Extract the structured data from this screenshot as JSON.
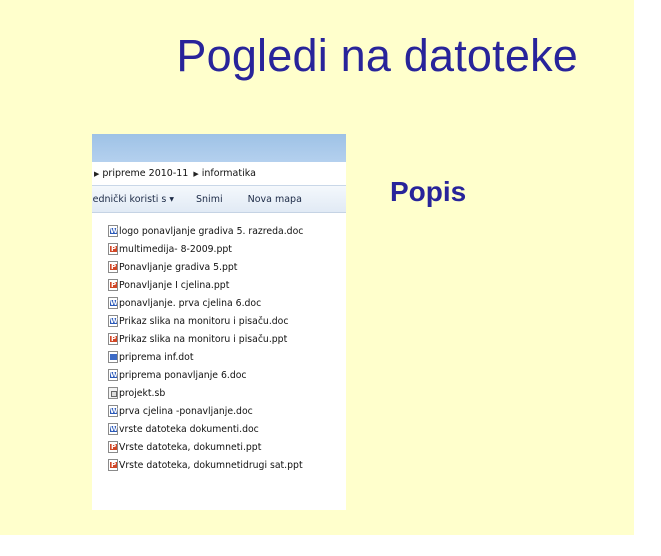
{
  "slide": {
    "title": "Pogledi na datoteke",
    "subtitle": "Popis"
  },
  "explorer": {
    "breadcrumb": [
      "pripreme 2010-11",
      "informatika"
    ],
    "toolbar": {
      "share_label": "jednički koristi s",
      "save_label": "Snimi",
      "new_folder_label": "Nova mapa"
    },
    "files": [
      {
        "name": "logo ponavljanje gradiva 5. razreda.doc",
        "icon": "word-doc-icon"
      },
      {
        "name": "multimedija- 8-2009.ppt",
        "icon": "powerpoint-icon"
      },
      {
        "name": "Ponavljanje gradiva 5.ppt",
        "icon": "powerpoint-icon"
      },
      {
        "name": "Ponavljanje I cjelina.ppt",
        "icon": "powerpoint-icon"
      },
      {
        "name": "ponavljanje. prva cjelina 6.doc",
        "icon": "word-doc-icon"
      },
      {
        "name": "Prikaz slika na monitoru i pisaču.doc",
        "icon": "word-doc-icon"
      },
      {
        "name": "Prikaz slika na monitoru i pisaču.ppt",
        "icon": "powerpoint-icon"
      },
      {
        "name": "priprema inf.dot",
        "icon": "word-template-icon"
      },
      {
        "name": "priprema ponavljanje 6.doc",
        "icon": "word-doc-icon"
      },
      {
        "name": "projekt.sb",
        "icon": "generic-file-icon"
      },
      {
        "name": "prva cjelina -ponavljanje.doc",
        "icon": "word-doc-icon"
      },
      {
        "name": "vrste datoteka dokumenti.doc",
        "icon": "word-doc-icon"
      },
      {
        "name": "Vrste datoteka, dokumneti.ppt",
        "icon": "powerpoint-icon"
      },
      {
        "name": "Vrste datoteka, dokumnetidrugi sat.ppt",
        "icon": "powerpoint-icon"
      }
    ]
  },
  "colors": {
    "slide_background": "#ffffcc",
    "title_text": "#28249a",
    "explorer_titlebar": "#9ec2e6"
  }
}
